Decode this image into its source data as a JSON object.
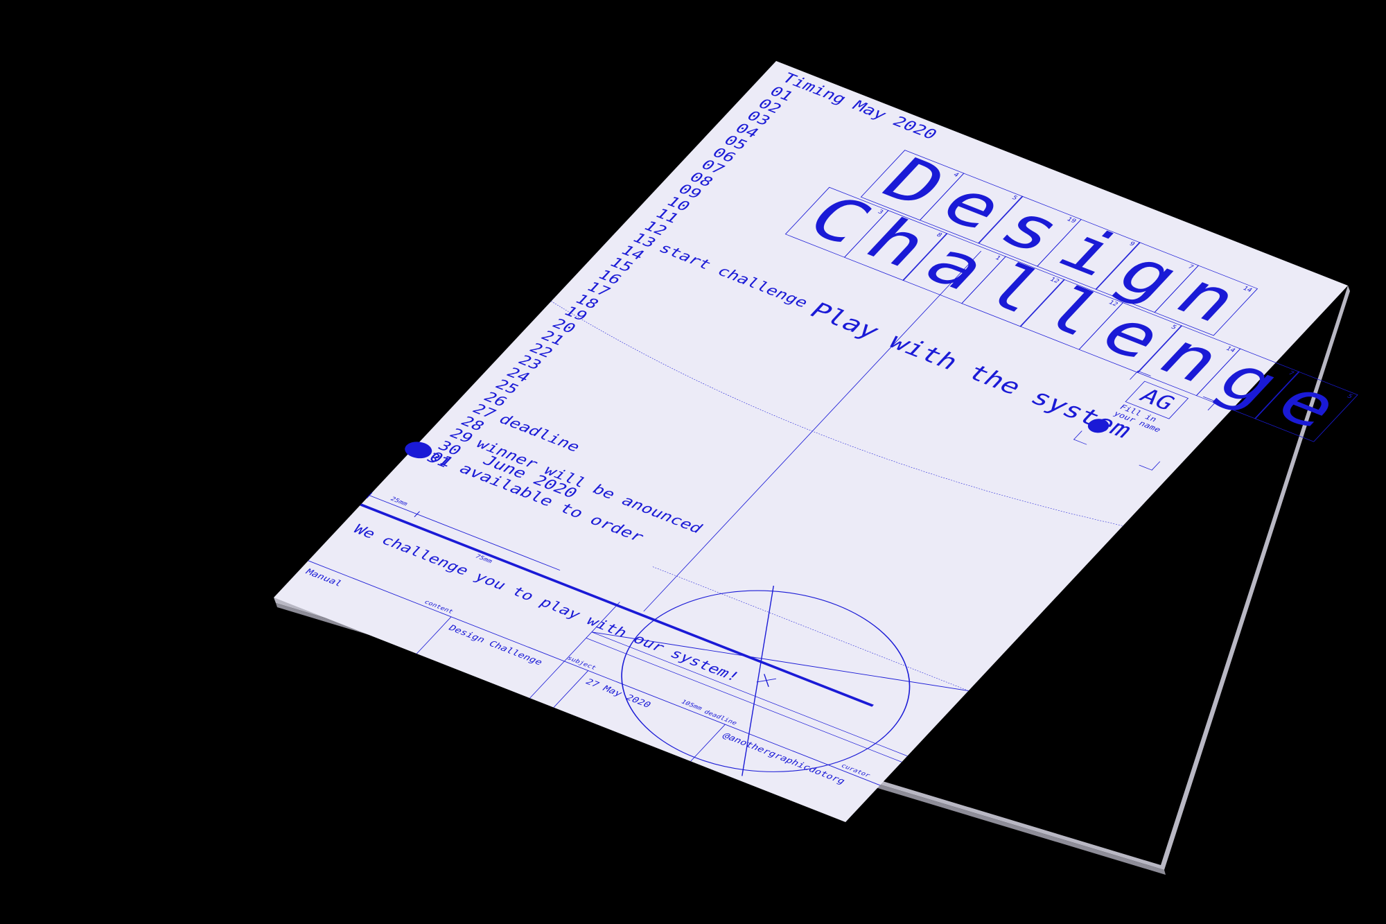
{
  "scene": {
    "background": "#000000",
    "paper_color": "#ecebf7",
    "ink_color": "#1a1ad6"
  },
  "timing": {
    "title": "Timing May 2020",
    "days": [
      {
        "num": "01",
        "note": ""
      },
      {
        "num": "02",
        "note": ""
      },
      {
        "num": "03",
        "note": ""
      },
      {
        "num": "04",
        "note": ""
      },
      {
        "num": "05",
        "note": ""
      },
      {
        "num": "06",
        "note": ""
      },
      {
        "num": "07",
        "note": ""
      },
      {
        "num": "08",
        "note": ""
      },
      {
        "num": "09",
        "note": ""
      },
      {
        "num": "10",
        "note": ""
      },
      {
        "num": "11",
        "note": ""
      },
      {
        "num": "12",
        "note": ""
      },
      {
        "num": "13",
        "note": "start challenge"
      },
      {
        "num": "14",
        "note": ""
      },
      {
        "num": "15",
        "note": ""
      },
      {
        "num": "16",
        "note": ""
      },
      {
        "num": "17",
        "note": ""
      },
      {
        "num": "18",
        "note": ""
      },
      {
        "num": "19",
        "note": ""
      },
      {
        "num": "20",
        "note": ""
      },
      {
        "num": "21",
        "note": ""
      },
      {
        "num": "22",
        "note": ""
      },
      {
        "num": "23",
        "note": ""
      },
      {
        "num": "24",
        "note": ""
      },
      {
        "num": "25",
        "note": ""
      },
      {
        "num": "26",
        "note": ""
      },
      {
        "num": "27",
        "note": "deadline"
      },
      {
        "num": "28",
        "note": ""
      },
      {
        "num": "29",
        "note": "winner will be anounced"
      },
      {
        "num": "30",
        "note": ""
      },
      {
        "num": "31",
        "note": ""
      }
    ],
    "june_title": "June 2020",
    "june_line": "01 available to order"
  },
  "title": {
    "line1": [
      {
        "char": "D",
        "num": "4"
      },
      {
        "char": "e",
        "num": "5"
      },
      {
        "char": "s",
        "num": "19"
      },
      {
        "char": "i",
        "num": "9"
      },
      {
        "char": "g",
        "num": "7"
      },
      {
        "char": "n",
        "num": "14"
      }
    ],
    "line2": [
      {
        "char": "C",
        "num": "3"
      },
      {
        "char": "h",
        "num": "8"
      },
      {
        "char": "a",
        "num": "1"
      },
      {
        "char": "l",
        "num": "12"
      },
      {
        "char": "l",
        "num": "12"
      },
      {
        "char": "e",
        "num": "5"
      },
      {
        "char": "n",
        "num": "14"
      },
      {
        "char": "g",
        "num": "7"
      },
      {
        "char": "e",
        "num": "5"
      }
    ]
  },
  "tagline": "Play with the system",
  "logo": {
    "text": "AG",
    "note": "Fill in your name"
  },
  "bottom": {
    "headline": "We challenge you to play with our system!",
    "measure_25": "25mm",
    "measure_75": "75mm",
    "measure_105": "105mm",
    "fields": [
      {
        "label": "content",
        "value": "Manual"
      },
      {
        "label": "subject",
        "value": "Design Challenge"
      },
      {
        "label": "deadline",
        "value": "27 May 2020"
      },
      {
        "label": "curator",
        "value": "@anothergraphicdotorg"
      }
    ]
  }
}
